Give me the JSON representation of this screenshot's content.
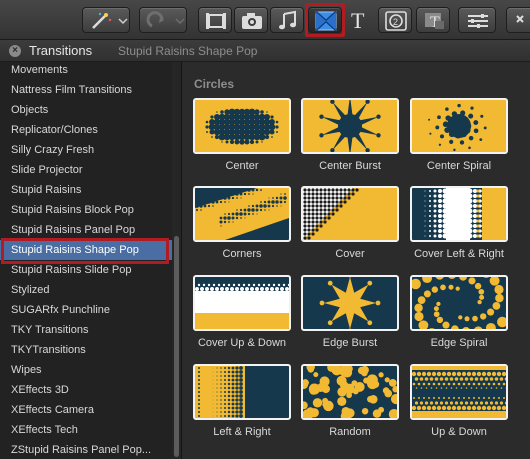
{
  "toolbar": {
    "buttons": [
      {
        "name": "magic-wand-icon",
        "menu": true
      },
      {
        "name": "enhance-icon",
        "menu": true
      },
      {
        "name": "clip-browser-icon"
      },
      {
        "name": "camera-icon"
      },
      {
        "name": "music-note-icon"
      },
      {
        "name": "transitions-icon",
        "selected": true
      },
      {
        "name": "titles-icon"
      },
      {
        "name": "generators-icon"
      },
      {
        "name": "themes-icon"
      },
      {
        "name": "inspector-icon"
      },
      {
        "name": "share-icon"
      }
    ]
  },
  "header": {
    "close_label": "×",
    "title": "Transitions",
    "subtitle": "Stupid Raisins Shape Pop"
  },
  "sidebar": {
    "items": [
      {
        "label": "Movements"
      },
      {
        "label": "Nattress Film Transitions"
      },
      {
        "label": "Objects"
      },
      {
        "label": "Replicator/Clones"
      },
      {
        "label": "Silly Crazy Fresh"
      },
      {
        "label": "Slide Projector"
      },
      {
        "label": "Stupid Raisins"
      },
      {
        "label": "Stupid Raisins Block Pop"
      },
      {
        "label": "Stupid Raisins Panel Pop"
      },
      {
        "label": "Stupid Raisins Shape Pop",
        "selected": true
      },
      {
        "label": "Stupid Raisins Slide Pop"
      },
      {
        "label": "Stylized"
      },
      {
        "label": "SUGARfx Punchline"
      },
      {
        "label": "TKY Transitions"
      },
      {
        "label": "TKYTransitions"
      },
      {
        "label": "Wipes"
      },
      {
        "label": "XEffects 3D"
      },
      {
        "label": "XEffects Camera"
      },
      {
        "label": "XEffects Tech"
      },
      {
        "label": "ZStupid Raisins Panel Pop..."
      }
    ]
  },
  "main": {
    "section_title": "Circles",
    "tiles": [
      {
        "label": "Center",
        "pattern": "center"
      },
      {
        "label": "Center Burst",
        "pattern": "center-burst"
      },
      {
        "label": "Center Spiral",
        "pattern": "center-spiral"
      },
      {
        "label": "Corners",
        "pattern": "corners"
      },
      {
        "label": "Cover",
        "pattern": "cover"
      },
      {
        "label": "Cover Left & Right",
        "pattern": "cover-left-right"
      },
      {
        "label": "Cover Up & Down",
        "pattern": "cover-up-down"
      },
      {
        "label": "Edge Burst",
        "pattern": "edge-burst"
      },
      {
        "label": "Edge Spiral",
        "pattern": "edge-spiral"
      },
      {
        "label": "Left & Right",
        "pattern": "left-right"
      },
      {
        "label": "Random",
        "pattern": "random"
      },
      {
        "label": "Up & Down",
        "pattern": "up-down"
      }
    ]
  },
  "colors": {
    "yellow": "#f2b933",
    "navy": "#16384c",
    "selection": "#4a6ea3",
    "highlight_ring": "#b01c22"
  }
}
